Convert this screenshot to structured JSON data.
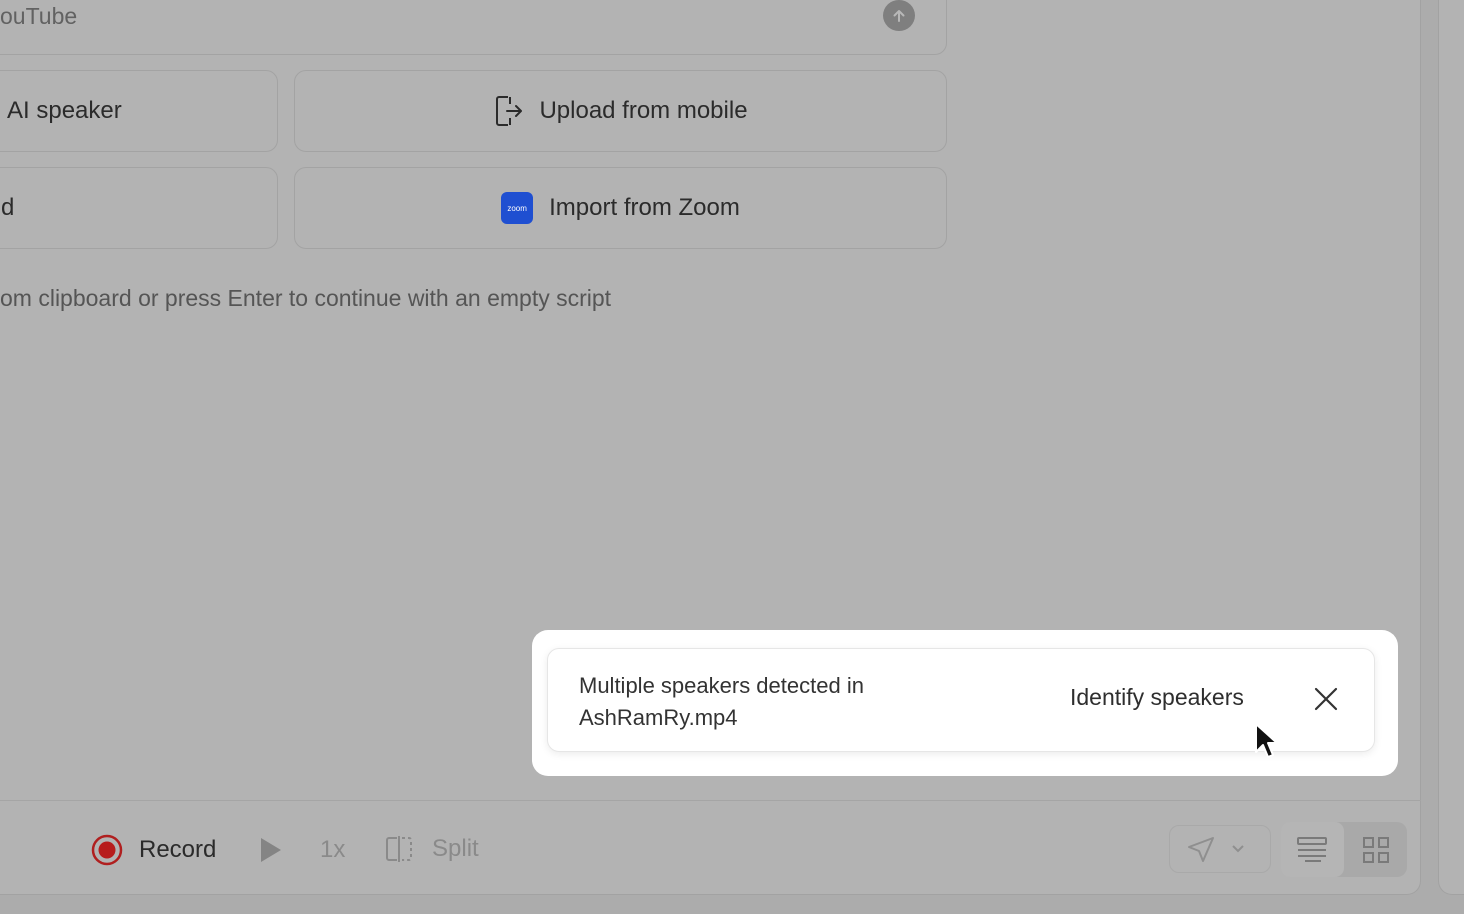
{
  "import": {
    "youtube_placeholder": "ouTube",
    "ai_speaker_label": "AI speaker",
    "upload_mobile_label": "Upload from mobile",
    "left_card_partial_label": "d",
    "zoom_label": "Import from Zoom",
    "zoom_logo_text": "zoom",
    "hint": "om clipboard or press Enter to continue with an empty script"
  },
  "toolbar": {
    "record_label": "Record",
    "speed_label": "1x",
    "split_label": "Split"
  },
  "toast": {
    "message_line1": "Multiple speakers detected in",
    "message_line2": "AshRamRy.mp4",
    "action_label": "Identify speakers"
  },
  "colors": {
    "overlay": "#b3b3b3",
    "record_red": "#c62828",
    "zoom_blue": "#1f4fd1",
    "toast_bg": "#ffffff"
  }
}
